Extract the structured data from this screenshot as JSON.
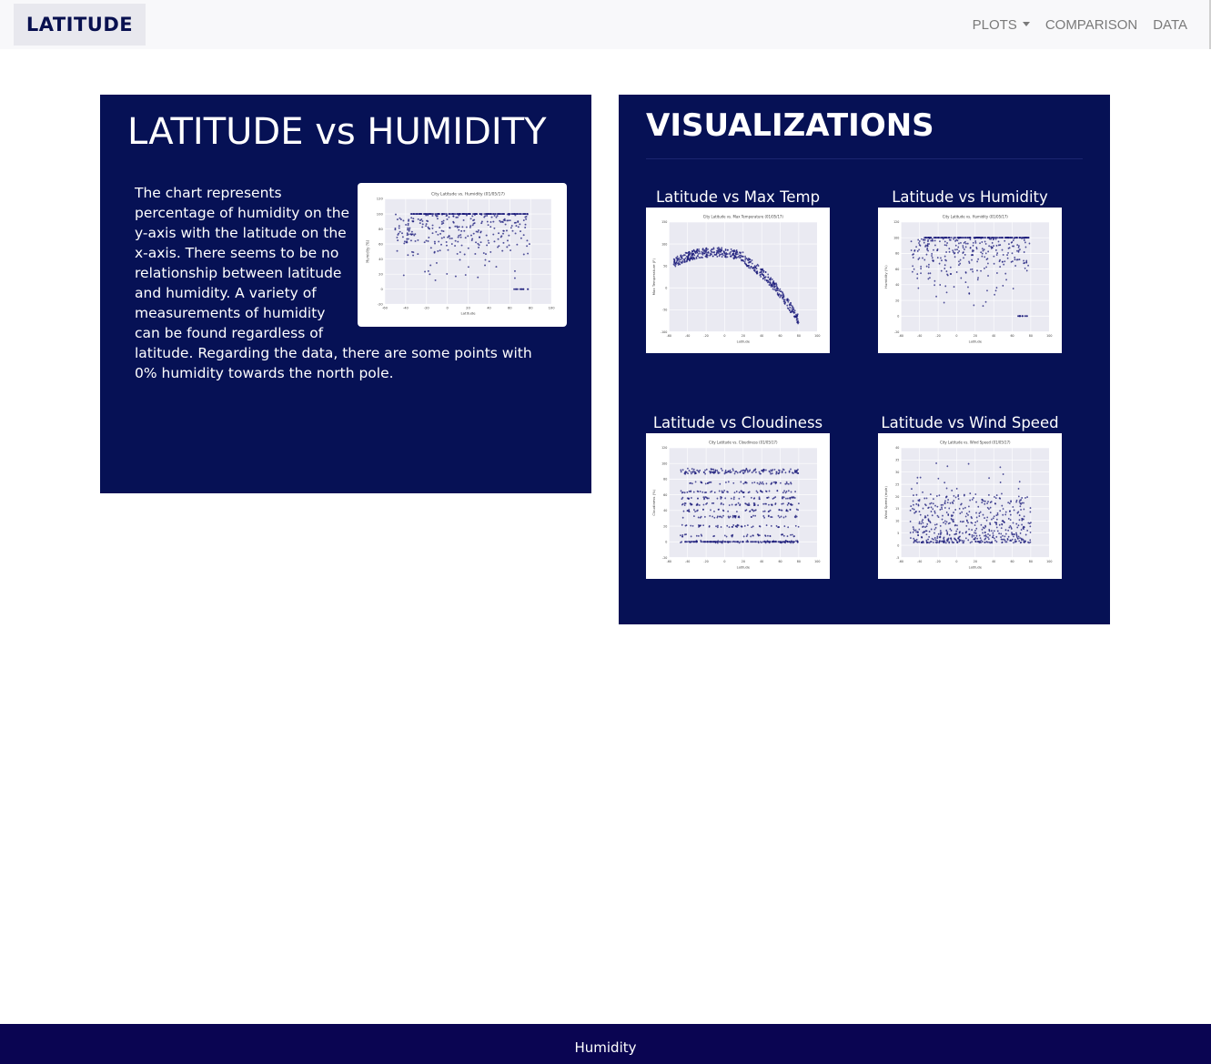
{
  "nav": {
    "brand": "LATITUDE",
    "plots_label": "PLOTS",
    "comparison_label": "COMPARISON",
    "data_label": "DATA"
  },
  "main": {
    "title": "LATITUDE vs HUMIDITY",
    "description": "The chart represents percentage of humidity on the y-axis with the latitude on the x-axis. There seems to be no relationship between latitude and humidity. A variety of measurements of humidity can be found regardless of latitude. Regarding the data, there are some points with 0% humidity towards the north pole."
  },
  "visualizations": {
    "title": "VISUALIZATIONS",
    "items": [
      {
        "label": "Latitude vs Max Temp",
        "plot": "temp"
      },
      {
        "label": "Latitude vs Humidity",
        "plot": "humidity"
      },
      {
        "label": "Latitude vs Cloudiness",
        "plot": "cloudiness"
      },
      {
        "label": "Latitude vs Wind Speed",
        "plot": "wind"
      }
    ]
  },
  "footer": {
    "text": "Humidity"
  },
  "colors": {
    "panel": "#061155",
    "footer": "#0a0552",
    "brand_text": "#08104f",
    "marker": "#1a1a7a"
  },
  "chart_data": [
    {
      "id": "humidity",
      "type": "scatter",
      "title": "City Latitude vs. Humidity (01/05/17)",
      "xlabel": "Latitude",
      "ylabel": "Humidity (%)",
      "xlim": [
        -60,
        100
      ],
      "ylim": [
        -20,
        120
      ],
      "xticks": [
        "-60",
        "-40",
        "-20",
        "0",
        "20",
        "40",
        "60",
        "80",
        "100"
      ],
      "yticks": [
        "-20",
        "0",
        "20",
        "40",
        "60",
        "80",
        "100",
        "120"
      ]
    },
    {
      "id": "temp",
      "type": "scatter",
      "title": "City Latitude vs. Max Temperature (01/05/17)",
      "xlabel": "Latitude",
      "ylabel": "Max Temperature (F)",
      "xlim": [
        -60,
        100
      ],
      "ylim": [
        -100,
        150
      ],
      "xticks": [
        "-60",
        "-40",
        "-20",
        "0",
        "20",
        "40",
        "60",
        "80",
        "100"
      ],
      "yticks": [
        "-100",
        "-50",
        "0",
        "50",
        "100",
        "150"
      ]
    },
    {
      "id": "cloudiness",
      "type": "scatter",
      "title": "City Latitude vs. Cloudiness (01/05/17)",
      "xlabel": "Latitude",
      "ylabel": "Cloudiness (%)",
      "xlim": [
        -60,
        100
      ],
      "ylim": [
        -20,
        120
      ],
      "xticks": [
        "-60",
        "-40",
        "-20",
        "0",
        "20",
        "40",
        "60",
        "80",
        "100"
      ],
      "yticks": [
        "-20",
        "0",
        "20",
        "40",
        "60",
        "80",
        "100",
        "120"
      ]
    },
    {
      "id": "wind",
      "type": "scatter",
      "title": "City Latitude vs. Wind Speed (01/05/17)",
      "xlabel": "Latitude",
      "ylabel": "Wind Speed (mph)",
      "xlim": [
        -60,
        100
      ],
      "ylim": [
        -5,
        40
      ],
      "xticks": [
        "-60",
        "-40",
        "-20",
        "0",
        "20",
        "40",
        "60",
        "80",
        "100"
      ],
      "yticks": [
        "-5",
        "0",
        "5",
        "10",
        "15",
        "20",
        "25",
        "30",
        "35",
        "40"
      ]
    }
  ]
}
